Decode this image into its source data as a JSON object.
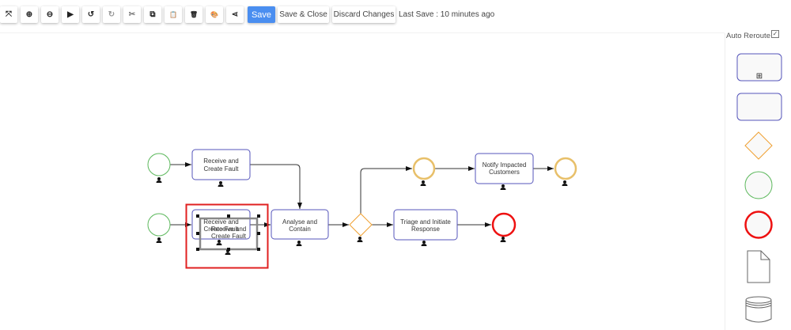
{
  "toolbar": {
    "icons": [
      "fit-screen-icon",
      "zoom-in-icon",
      "zoom-out-icon",
      "play-icon",
      "undo-icon",
      "redo-icon",
      "cut-icon",
      "copy-icon",
      "paste-icon",
      "delete-icon",
      "palette-icon",
      "share-icon"
    ],
    "glyphs": [
      "⤧",
      "⊕",
      "⊖",
      "▶",
      "↺",
      "↻",
      "✂",
      "⧉",
      "📋",
      "🗑",
      "🎨",
      "⋖"
    ],
    "save_label": "Save",
    "save_close_label": "Save & Close",
    "discard_label": "Discard Changes",
    "last_save": "Last Save : 10 minutes ago"
  },
  "palette": {
    "auto_reroute_label": "Auto Reroute",
    "auto_reroute_checked": true,
    "subprocess_marker": "⊞"
  },
  "diagram": {
    "tasks": {
      "t1": [
        "Receive and",
        "Create Fault"
      ],
      "t2": [
        "Receive and",
        "Create Fault"
      ],
      "ghost": [
        "Receive and",
        "Create Fault"
      ],
      "t3": [
        "Analyse and",
        "Contain"
      ],
      "t4": [
        "Notify Impacted",
        "Customers"
      ],
      "t5": [
        "Triage and Initiate",
        "Response"
      ]
    },
    "colors": {
      "start": "#5cb85c",
      "end": "#ee1111",
      "intermediate": "#e8c06a",
      "gateway": "#f0a030",
      "task_border": "#5555bb",
      "selection": "#e02020",
      "save": "#4a8ef0"
    }
  }
}
